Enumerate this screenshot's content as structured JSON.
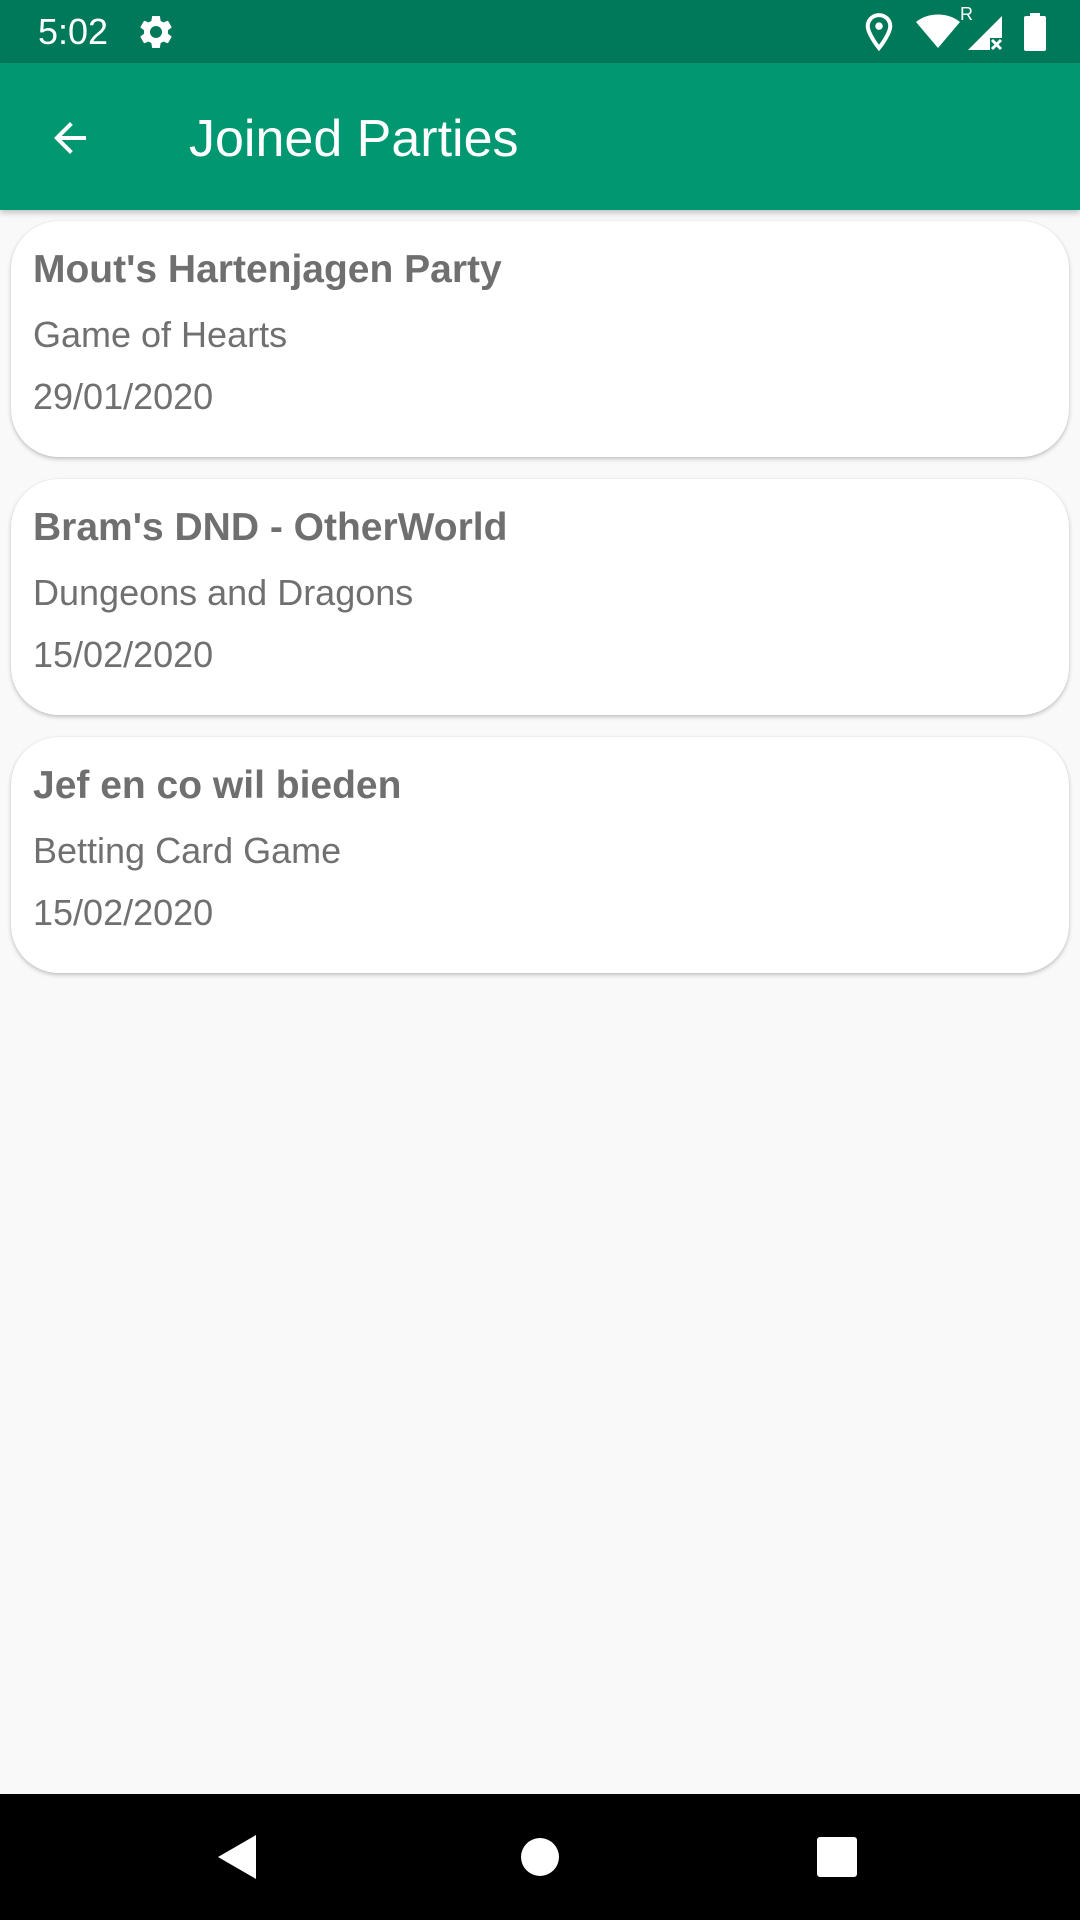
{
  "status_bar": {
    "time": "5:02",
    "icons": [
      "settings-icon",
      "location-icon",
      "wifi-icon",
      "signal-roaming-icon",
      "battery-icon"
    ],
    "roaming_label": "R"
  },
  "app_bar": {
    "title": "Joined Parties",
    "back_icon": "arrow-back-icon",
    "color": "#009771",
    "status_color": "#00795a"
  },
  "parties": [
    {
      "name": "Mout's Hartenjagen Party",
      "game": "Game of Hearts",
      "date": "29/01/2020"
    },
    {
      "name": "Bram's DND - OtherWorld",
      "game": "Dungeons and Dragons",
      "date": "15/02/2020"
    },
    {
      "name": "Jef en co wil bieden",
      "game": "Betting Card Game",
      "date": "15/02/2020"
    }
  ],
  "nav_bar": {
    "icons": [
      "back-triangle-icon",
      "home-circle-icon",
      "recents-square-icon"
    ]
  }
}
